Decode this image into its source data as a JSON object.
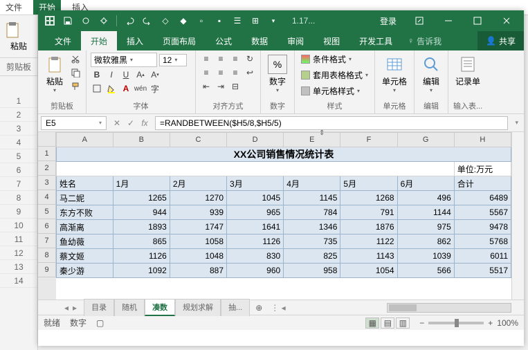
{
  "bg": {
    "tabs": [
      "文件",
      "开始",
      "插入",
      "页面布局",
      "公式",
      "数据",
      "审阅",
      "视图",
      "开发工具"
    ],
    "paste": "粘贴",
    "clipboard": "剪贴板",
    "rows": [
      "1",
      "2",
      "3",
      "4",
      "5",
      "6",
      "7",
      "8",
      "9",
      "10",
      "11",
      "12",
      "13",
      "14"
    ]
  },
  "titlebar": {
    "filename": "1.17...",
    "login": "登录"
  },
  "ribbonTabs": {
    "file": "文件",
    "home": "开始",
    "insert": "插入",
    "layout": "页面布局",
    "formula": "公式",
    "data": "数据",
    "review": "审阅",
    "view": "视图",
    "dev": "开发工具",
    "tell": "告诉我",
    "share": "共享"
  },
  "ribbon": {
    "clipboard": {
      "paste": "粘贴",
      "label": "剪贴板"
    },
    "font": {
      "family": "微软雅黑",
      "size": "12",
      "bold": "B",
      "italic": "I",
      "underline": "U",
      "label": "字体"
    },
    "align": {
      "label": "对齐方式"
    },
    "number": {
      "title": "数字",
      "label": "数字",
      "percent": "%"
    },
    "styles": {
      "cond": "条件格式",
      "table": "套用表格格式",
      "cell": "单元格样式",
      "label": "样式"
    },
    "cells": {
      "label": "单元格"
    },
    "editing": {
      "label": "编辑"
    },
    "record": {
      "title": "记录单",
      "label": "输入表..."
    }
  },
  "formulaBar": {
    "name": "E5",
    "fx": "fx",
    "formula": "=RANDBETWEEN($H5/8,$H5/5)"
  },
  "sheet": {
    "cols": [
      "A",
      "B",
      "C",
      "D",
      "E",
      "F",
      "G",
      "H"
    ],
    "rows": [
      "1",
      "2",
      "3",
      "4",
      "5",
      "6",
      "7",
      "8",
      "9"
    ],
    "title": "XX公司销售情况统计表",
    "unit": "单位:万元",
    "headers": [
      "姓名",
      "1月",
      "2月",
      "3月",
      "4月",
      "5月",
      "6月",
      "合计"
    ],
    "data": [
      {
        "name": "马二妮",
        "v": [
          1265,
          1270,
          1045,
          1145,
          1268,
          496,
          6489
        ]
      },
      {
        "name": "东方不败",
        "v": [
          944,
          939,
          965,
          784,
          791,
          1144,
          5567
        ]
      },
      {
        "name": "高渐离",
        "v": [
          1893,
          1747,
          1641,
          1346,
          1876,
          975,
          9478
        ]
      },
      {
        "name": "鱼幼薇",
        "v": [
          865,
          1058,
          1126,
          735,
          1122,
          862,
          5768
        ]
      },
      {
        "name": "蔡文姬",
        "v": [
          1126,
          1048,
          830,
          825,
          1143,
          1039,
          6011
        ]
      },
      {
        "name": "秦少游",
        "v": [
          1092,
          887,
          960,
          958,
          1054,
          566,
          5517
        ]
      }
    ]
  },
  "sheetTabs": {
    "items": [
      "目录",
      "随机",
      "凑数",
      "规划求解",
      "抽..."
    ],
    "active": 2
  },
  "status": {
    "ready": "就绪",
    "num": "数字",
    "zoom": "100%"
  },
  "chart_data": {
    "type": "table",
    "title": "XX公司销售情况统计表",
    "unit": "万元",
    "columns": [
      "姓名",
      "1月",
      "2月",
      "3月",
      "4月",
      "5月",
      "6月",
      "合计"
    ],
    "rows": [
      [
        "马二妮",
        1265,
        1270,
        1045,
        1145,
        1268,
        496,
        6489
      ],
      [
        "东方不败",
        944,
        939,
        965,
        784,
        791,
        1144,
        5567
      ],
      [
        "高渐离",
        1893,
        1747,
        1641,
        1346,
        1876,
        975,
        9478
      ],
      [
        "鱼幼薇",
        865,
        1058,
        1126,
        735,
        1122,
        862,
        5768
      ],
      [
        "蔡文姬",
        1126,
        1048,
        830,
        825,
        1143,
        1039,
        6011
      ],
      [
        "秦少游",
        1092,
        887,
        960,
        958,
        1054,
        566,
        5517
      ]
    ]
  }
}
